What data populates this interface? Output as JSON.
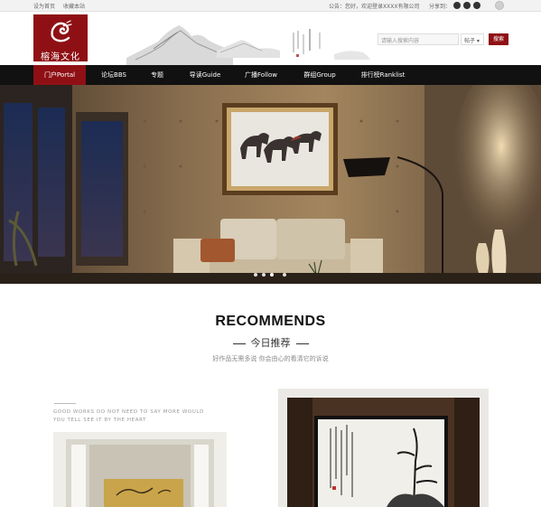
{
  "topbar": {
    "set_home": "设为首页",
    "bookmark": "收藏本站",
    "notice": "公告：您好，欢迎登录XXXX有限公司",
    "share_label": "分享到："
  },
  "header": {
    "logo_text": "榕海文化",
    "search_placeholder": "请输入搜索内容",
    "search_scope": "帖子 ▾",
    "search_button": "搜索"
  },
  "nav": {
    "items": [
      {
        "label": "门户Portal",
        "active": true
      },
      {
        "label": "论坛BBS"
      },
      {
        "label": "专题"
      },
      {
        "label": "导读Guide"
      },
      {
        "label": "广播Follow"
      },
      {
        "label": "群组Group"
      },
      {
        "label": "排行榜Ranklist"
      }
    ]
  },
  "hero": {
    "slide_count": 4,
    "active_slide": 2
  },
  "recommends": {
    "title": "RECOMMENDS",
    "subtitle": "今日推荐",
    "description": "好作品无需多说 你会由心的看清它的诉说",
    "works_line1": "GOOD WORKS DO NOT NEED TO SAY MORE WOULD",
    "works_line2": "YOU TELL SEE IT BY THE HEART"
  },
  "colors": {
    "brand": "#8e1014",
    "nav_bg": "#111111"
  }
}
